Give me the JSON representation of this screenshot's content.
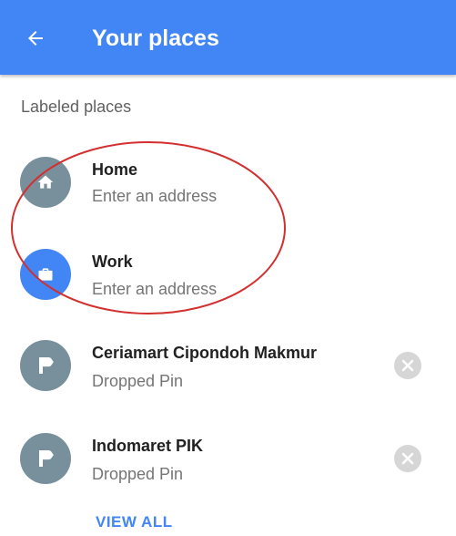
{
  "appbar": {
    "title": "Your places",
    "back_icon": "arrow-back-icon",
    "color": "#4285f4"
  },
  "section": {
    "header": "Labeled places"
  },
  "labeled": [
    {
      "title": "Home",
      "subtitle": "Enter an address",
      "icon": "home-icon",
      "avatar_color": "#78909c"
    },
    {
      "title": "Work",
      "subtitle": "Enter an address",
      "icon": "briefcase-icon",
      "avatar_color": "#4285f4"
    }
  ],
  "pins": [
    {
      "title": "Ceriamart Cipondoh Makmur",
      "subtitle": "Dropped Pin",
      "icon": "flag-pin-icon",
      "remove_icon": "remove-circle-icon"
    },
    {
      "title": "Indomaret PIK",
      "subtitle": "Dropped Pin",
      "icon": "flag-pin-icon",
      "remove_icon": "remove-circle-icon"
    }
  ],
  "footer": {
    "view_all": "VIEW ALL"
  },
  "annotation": {
    "shape": "ellipse",
    "color": "#d32f2f"
  }
}
